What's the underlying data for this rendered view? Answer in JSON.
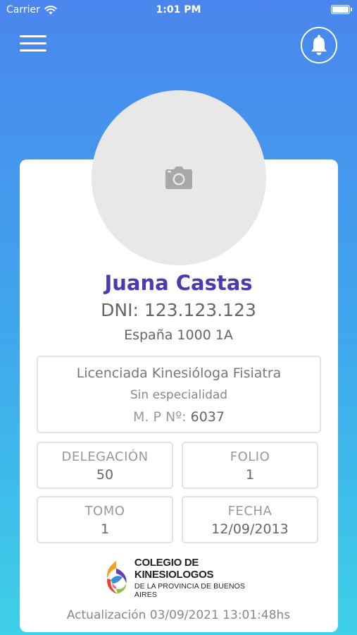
{
  "status_bar": {
    "carrier": "Carrier",
    "time": "1:01 PM"
  },
  "profile": {
    "name": "Juana Castas",
    "dni": "DNI: 123.123.123",
    "address": "España 1000 1A"
  },
  "credential": {
    "title": "Licenciada Kinesióloga Fisiatra",
    "specialty": "Sin especialidad",
    "mp_label": "M. P Nº:",
    "mp_value": "6037"
  },
  "fields": {
    "delegacion": {
      "label": "DELEGACIÓN",
      "value": "50"
    },
    "folio": {
      "label": "FOLIO",
      "value": "1"
    },
    "tomo": {
      "label": "TOMO",
      "value": "1"
    },
    "fecha": {
      "label": "FECHA",
      "value": "12/09/2013"
    }
  },
  "logo": {
    "line1": "COLEGIO DE KINESIOLOGOS",
    "line2": "DE LA PROVINCIA DE BUENOS AIRES"
  },
  "footer": {
    "updated": "Actualización 03/09/2021 13:01:48hs"
  },
  "icons": {
    "menu": "hamburger-icon",
    "notifications": "bell-icon",
    "photo": "camera-icon",
    "wifi": "wifi-icon",
    "battery": "battery-icon"
  },
  "colors": {
    "gradient_top": "#4a86ee",
    "gradient_bottom": "#3ed0e8",
    "name": "#4b3ab0"
  }
}
